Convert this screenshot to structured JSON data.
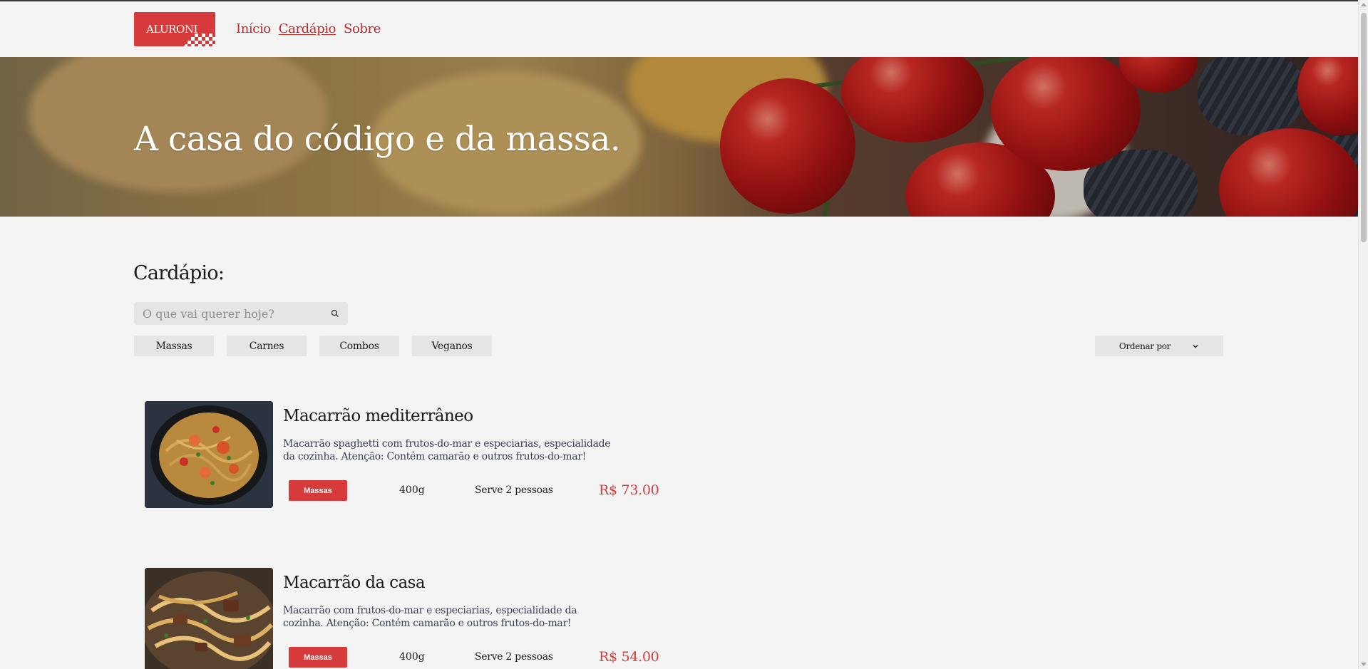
{
  "header": {
    "logo_text": "ALURONI",
    "nav": [
      {
        "label": "Início",
        "active": false
      },
      {
        "label": "Cardápio",
        "active": true
      },
      {
        "label": "Sobre",
        "active": false
      }
    ]
  },
  "hero": {
    "title": "A casa do código e da massa."
  },
  "menu": {
    "title": "Cardápio:",
    "search_placeholder": "O que vai querer hoje?",
    "filters": [
      "Massas",
      "Carnes",
      "Combos",
      "Veganos"
    ],
    "sort_label": "Ordenar por",
    "items": [
      {
        "title": "Macarrão mediterrâneo",
        "description": "Macarrão spaghetti com frutos-do-mar e especiarias, especialidade da cozinha. Atenção: Contém camarão e outros frutos-do-mar!",
        "category": "Massas",
        "size": "400g",
        "serving": "Serve 2 pessoas",
        "price": "R$ 73.00"
      },
      {
        "title": "Macarrão da casa",
        "description": "Macarrão com frutos-do-mar e especiarias, especialidade da cozinha. Atenção: Contém camarão e outros frutos-do-mar!",
        "category": "Massas",
        "size": "400g",
        "serving": "Serve 2 pessoas",
        "price": "R$ 54.00"
      }
    ]
  },
  "colors": {
    "accent": "#d73a3a",
    "nav_link": "#c62828",
    "background": "#f4f4f4",
    "button_bg": "#e5e5e5"
  }
}
